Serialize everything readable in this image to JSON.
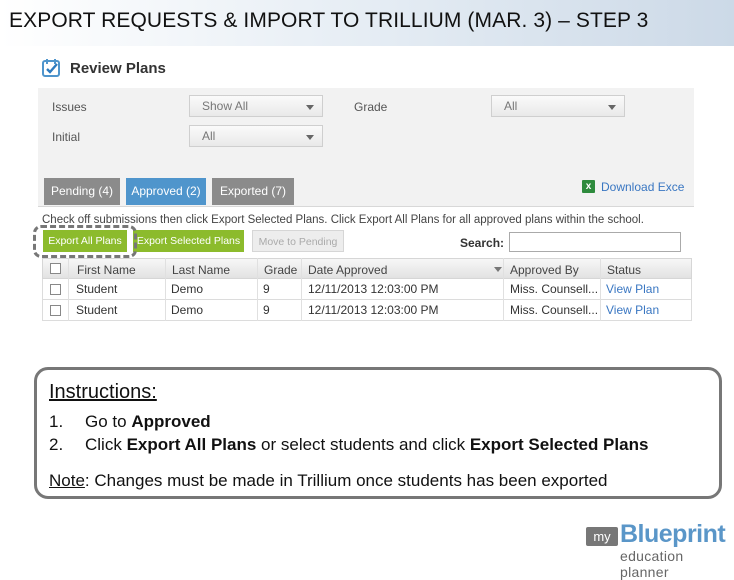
{
  "slide": {
    "title": "EXPORT REQUESTS & IMPORT TO TRILLIUM (MAR. 3) – STEP 3"
  },
  "review_plans": {
    "title": "Review Plans",
    "filters": {
      "issues_label": "Issues",
      "issues_value": "Show All",
      "grade_label": "Grade",
      "grade_value": "All",
      "initial_label": "Initial",
      "initial_value": "All"
    },
    "tabs": [
      {
        "label": "Pending (4)",
        "active": false
      },
      {
        "label": "Approved (2)",
        "active": true
      },
      {
        "label": "Exported (7)",
        "active": false
      }
    ],
    "download_label": "Download Exce",
    "hint_text": "Check off submissions then click Export Selected Plans. Click Export All Plans for all approved plans within the school.",
    "buttons": {
      "export_all": "Export All Plans",
      "export_selected": "Export Selected Plans",
      "move_to_pending": "Move to Pending"
    },
    "search_label": "Search:",
    "search_value": "",
    "columns": [
      "First Name",
      "Last Name",
      "Grade",
      "Date Approved",
      "Approved By",
      "Status"
    ],
    "rows": [
      {
        "first": "Student",
        "last": "Demo",
        "grade": "9",
        "date": "12/11/2013 12:03:00 PM",
        "by": "Miss. Counsell...",
        "status": "View Plan"
      },
      {
        "first": "Student",
        "last": "Demo",
        "grade": "9",
        "date": "12/11/2013 12:03:00 PM",
        "by": "Miss. Counsell...",
        "status": "View Plan"
      }
    ]
  },
  "instructions": {
    "title": "Instructions:",
    "step1_num": "1.",
    "step1_prefix": "Go to ",
    "step1_bold": "Approved",
    "step2_num": "2.",
    "step2_prefix": "Click ",
    "step2_bold1": "Export All Plans",
    "step2_mid": " or select students and click ",
    "step2_bold2": "Export Selected Plans",
    "note_label": "Note",
    "note_text": ": Changes must be made in Trillium once students has been exported"
  },
  "logo": {
    "my": "my",
    "blueprint": "Blueprint",
    "tagline": "education planner"
  },
  "colors": {
    "tab_active": "#4f95cc",
    "button_green": "#8cbb2c",
    "link": "#3a77c2"
  }
}
